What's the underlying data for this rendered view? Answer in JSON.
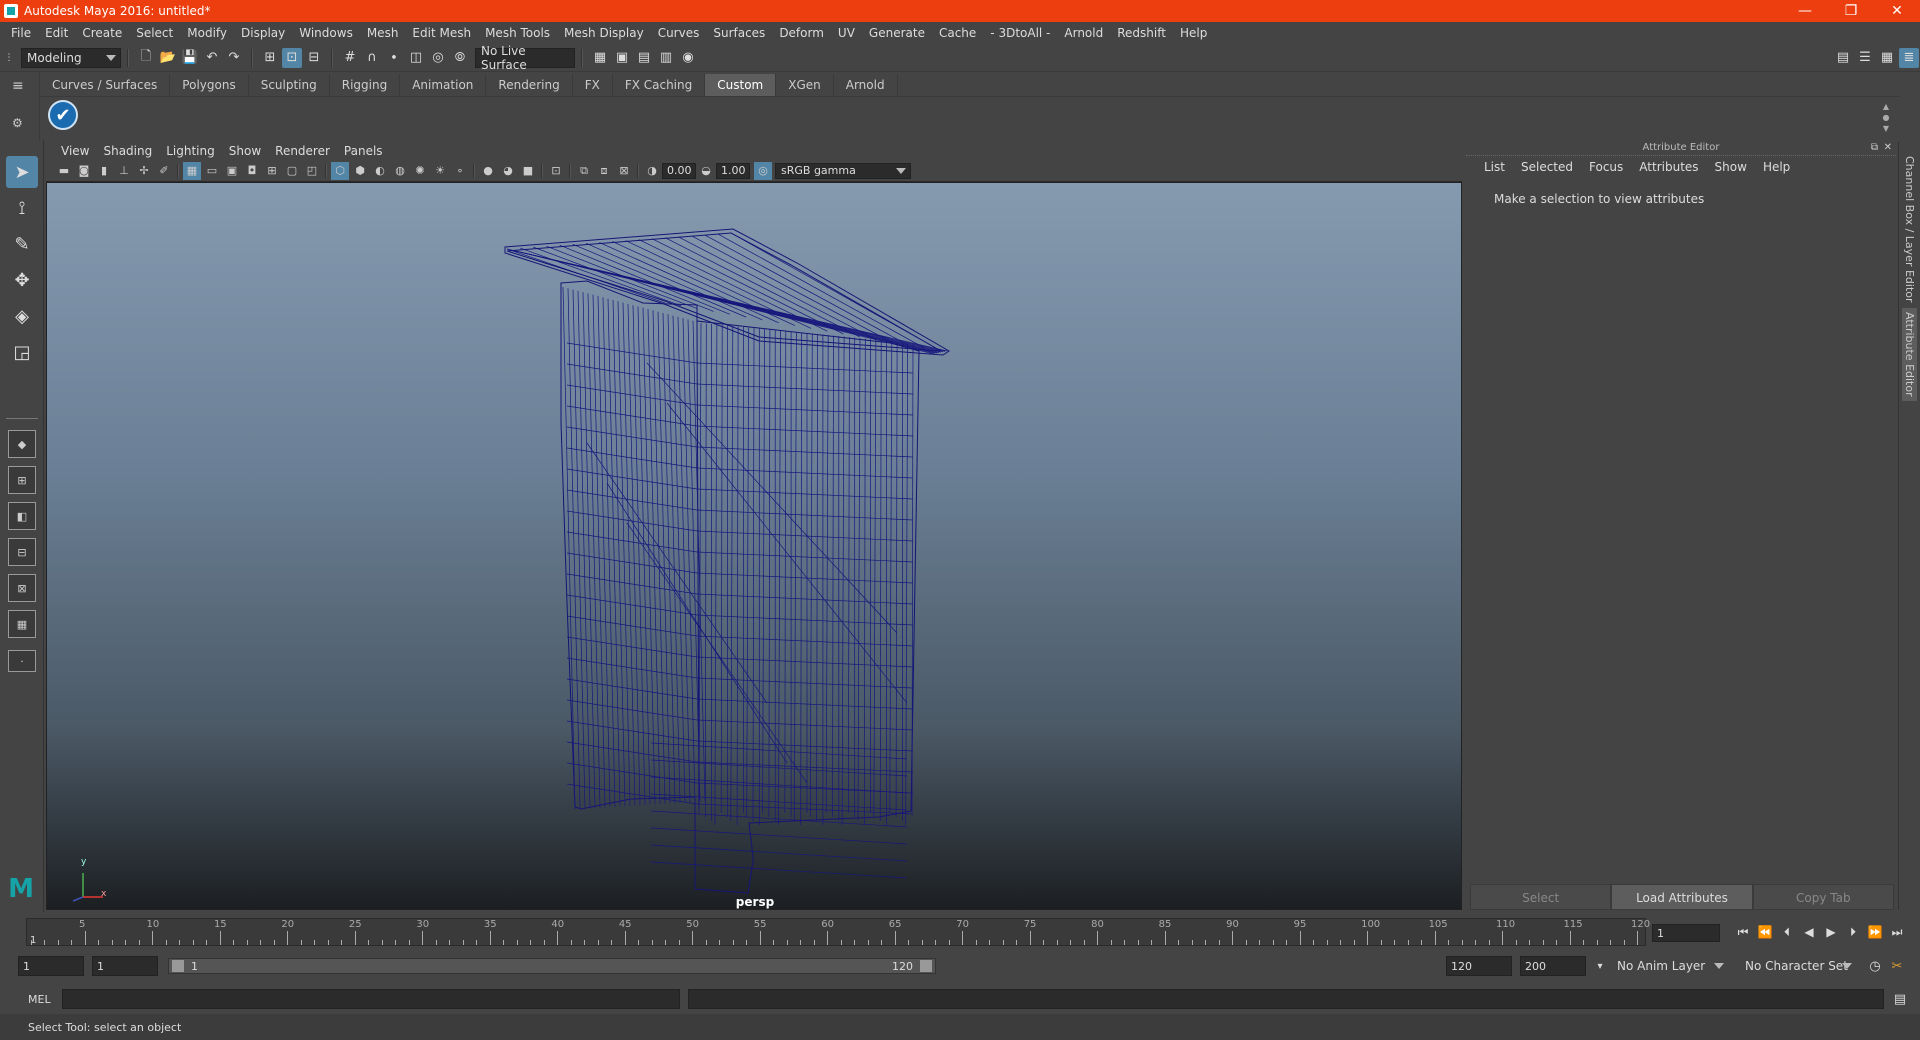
{
  "window": {
    "title": "Autodesk Maya 2016: untitled*",
    "controls": [
      "—",
      "❐",
      "✕"
    ]
  },
  "menu": [
    "File",
    "Edit",
    "Create",
    "Select",
    "Modify",
    "Display",
    "Windows",
    "Mesh",
    "Edit Mesh",
    "Mesh Tools",
    "Mesh Display",
    "Curves",
    "Surfaces",
    "Deform",
    "UV",
    "Generate",
    "Cache",
    "- 3DtoAll -",
    "Arnold",
    "Redshift",
    "Help"
  ],
  "statusline": {
    "mode": "Modeling",
    "live_surface": "No Live Surface"
  },
  "shelf": {
    "tabs": [
      "Curves / Surfaces",
      "Polygons",
      "Sculpting",
      "Rigging",
      "Animation",
      "Rendering",
      "FX",
      "FX Caching",
      "Custom",
      "XGen",
      "Arnold"
    ],
    "active": "Custom"
  },
  "viewport": {
    "menu": [
      "View",
      "Shading",
      "Lighting",
      "Show",
      "Renderer",
      "Panels"
    ],
    "exposure": "0.00",
    "gamma": "1.00",
    "colorspace": "sRGB gamma",
    "camera": "persp",
    "axis_x": "x",
    "axis_y": "y"
  },
  "attribute_editor": {
    "title": "Attribute Editor",
    "menu": [
      "List",
      "Selected",
      "Focus",
      "Attributes",
      "Show",
      "Help"
    ],
    "message": "Make a selection to view attributes",
    "buttons": [
      "Select",
      "Load Attributes",
      "Copy Tab"
    ]
  },
  "side_tabs": [
    "Channel Box / Layer Editor",
    "Attribute Editor"
  ],
  "timeline": {
    "ticks": [
      "5",
      "10",
      "15",
      "20",
      "25",
      "30",
      "35",
      "40",
      "45",
      "50",
      "55",
      "60",
      "65",
      "70",
      "75",
      "80",
      "85",
      "90",
      "95",
      "100",
      "105",
      "110",
      "115",
      "120"
    ],
    "start_marker": "1",
    "current_frame": "1"
  },
  "range": {
    "start": "1",
    "playback_start": "1",
    "slider_start": "1",
    "slider_end": "120",
    "playback_end": "120",
    "end": "200",
    "anim_layer": "No Anim Layer",
    "character_set": "No Character Set"
  },
  "command_line": {
    "label": "MEL"
  },
  "help_line": "Select Tool: select an object"
}
